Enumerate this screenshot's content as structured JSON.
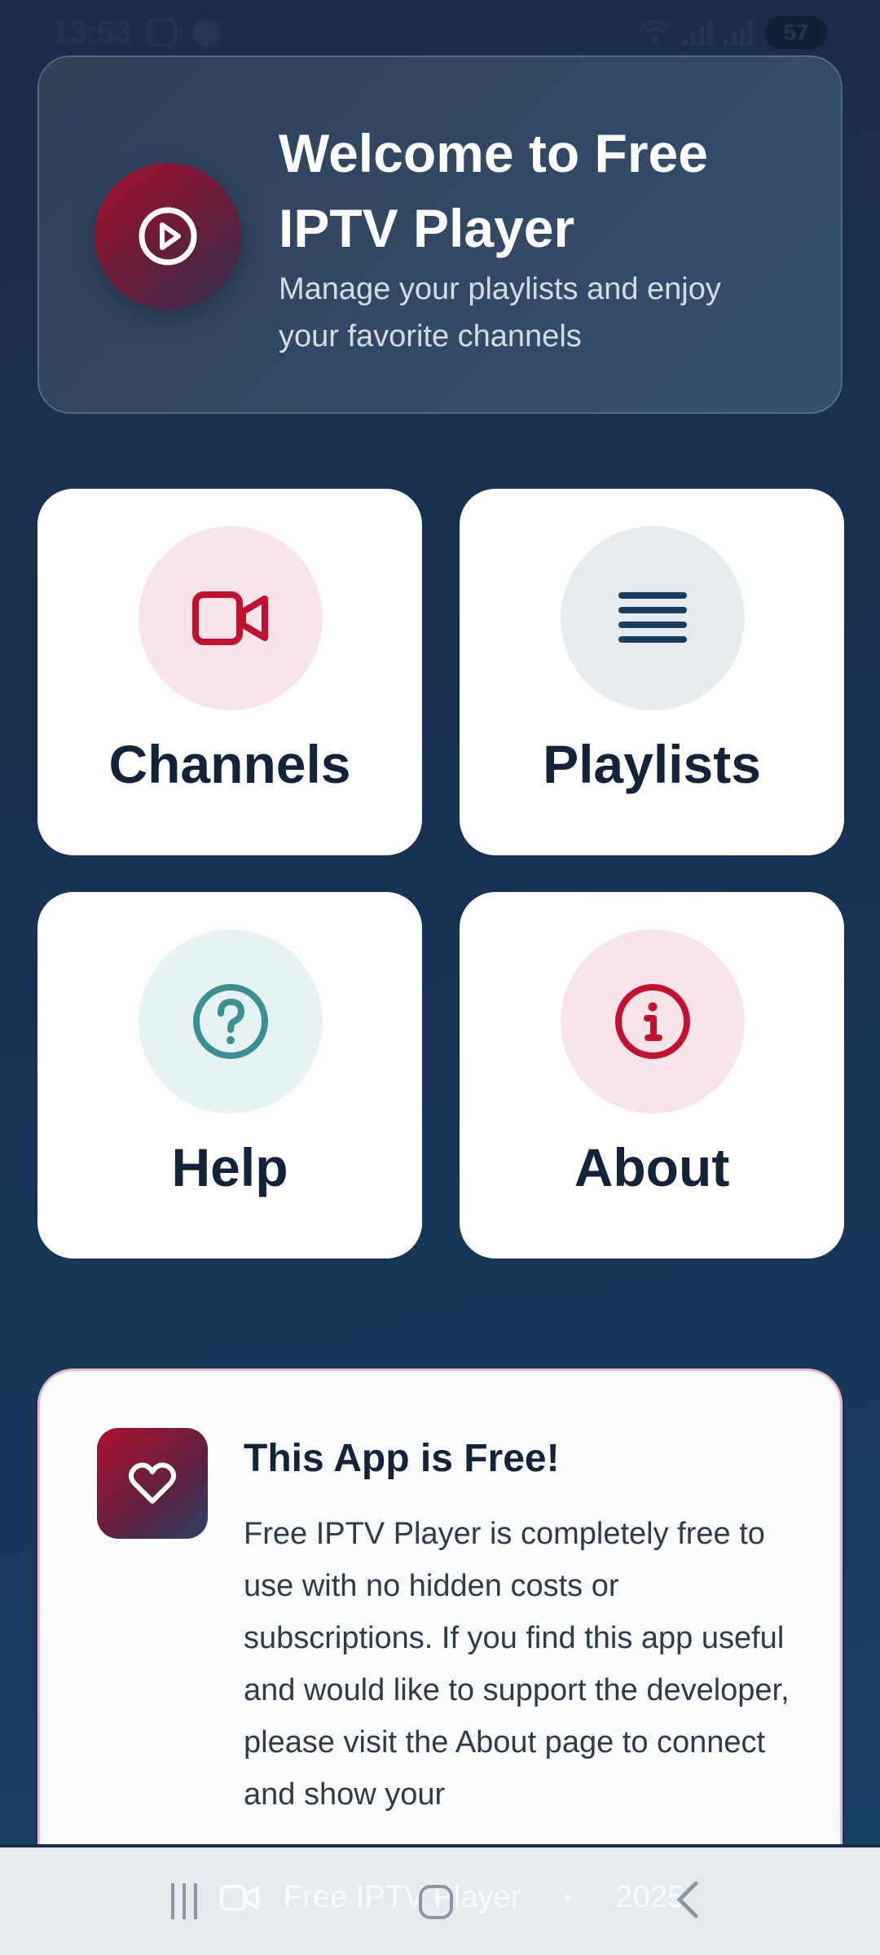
{
  "status_bar": {
    "time": "13:53",
    "battery": "57"
  },
  "welcome": {
    "title": "Welcome to Free IPTV Player",
    "subtitle": "Manage your playlists and enjoy your favorite channels",
    "logo_icon": "play-circle-icon"
  },
  "tiles": [
    {
      "label": "Channels",
      "icon": "video-camera-icon",
      "icon_color": "#c0122f",
      "circle_color": "#f8e4e8"
    },
    {
      "label": "Playlists",
      "icon": "list-icon",
      "icon_color": "#1a3e60",
      "circle_color": "#e6ebf0"
    },
    {
      "label": "Help",
      "icon": "help-circle-icon",
      "icon_color": "#3a9090",
      "circle_color": "#e7f3f3"
    },
    {
      "label": "About",
      "icon": "info-circle-icon",
      "icon_color": "#c0122f",
      "circle_color": "#f8e4e8"
    }
  ],
  "free_card": {
    "title": "This App is Free!",
    "body": "Free IPTV Player is completely free to use with no hidden costs or subscriptions. If you find this app useful and would like to support the developer, please visit the About page to connect and show your",
    "icon": "heart-icon"
  },
  "footer_ghost": {
    "app_name": "Free IPTV Player",
    "year": "2025"
  },
  "colors": {
    "background": "#173253",
    "accent_red": "#c0122f",
    "text_dark": "#13233b"
  }
}
